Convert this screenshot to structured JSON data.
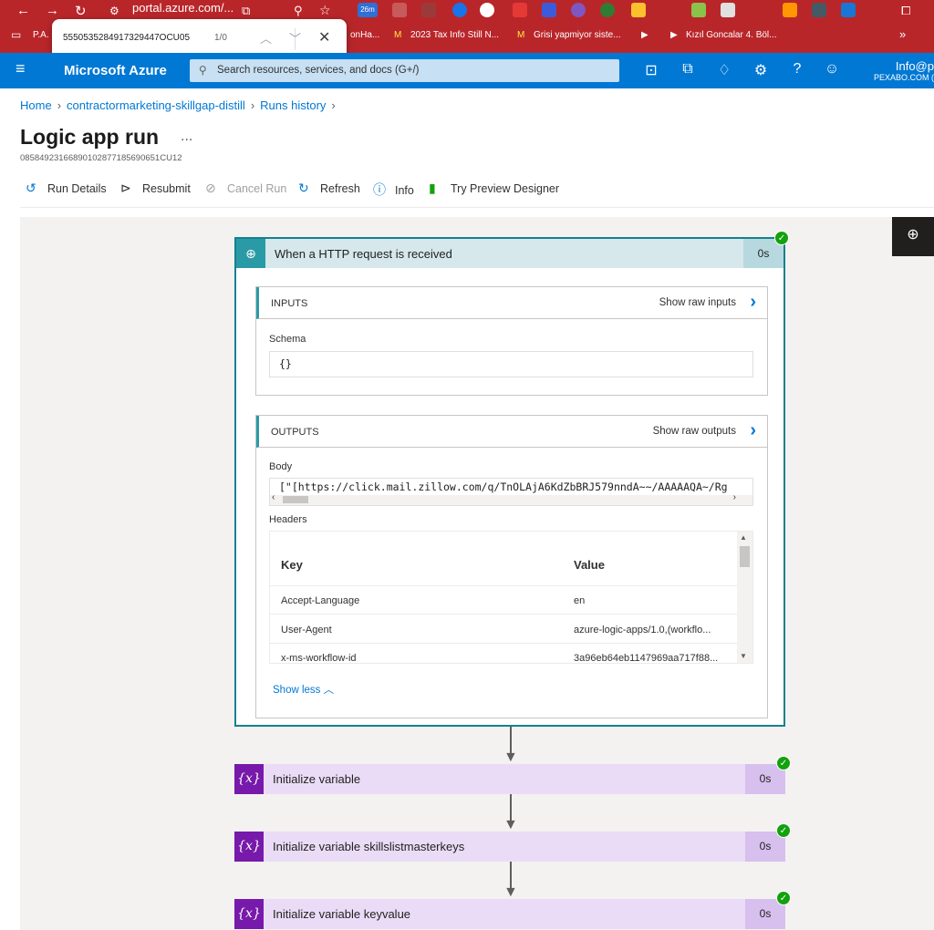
{
  "browser": {
    "url": "portal.azure.com/...",
    "badge_label": "26m",
    "bookmarks": [
      "P.A.",
      "onHa...",
      "2023 Tax Info Still N...",
      "Grisi yapmiyor siste...",
      "Kızıl Goncalar 4. Böl..."
    ],
    "more": "»"
  },
  "find_bar": {
    "query": "5550535284917329447OCU05",
    "count": "1/0"
  },
  "azure": {
    "brand": "Microsoft Azure",
    "search_placeholder": "Search resources, services, and docs (G+/)",
    "account_name": "Info@p",
    "account_org": "PEXABO.COM ("
  },
  "breadcrumb": [
    "Home",
    "contractormarketing-skillgap-distill",
    "Runs history"
  ],
  "page": {
    "title": "Logic app run",
    "more": "...",
    "run_id": "08584923166890102877185690651CU12"
  },
  "toolbar": {
    "run_details": "Run Details",
    "resubmit": "Resubmit",
    "cancel_run": "Cancel Run",
    "refresh": "Refresh",
    "info": "Info",
    "preview": "Try Preview Designer"
  },
  "http_step": {
    "title": "When a HTTP request is received",
    "duration": "0s",
    "inputs_label": "INPUTS",
    "show_raw_inputs": "Show raw inputs",
    "schema_label": "Schema",
    "schema_value": "{}",
    "outputs_label": "OUTPUTS",
    "show_raw_outputs": "Show raw outputs",
    "body_label": "Body",
    "body_value": "[\"[https://click.mail.zillow.com/q/TnOLAjA6KdZbBRJ579nndA~~/AAAAAQA~/Rg",
    "headers_label": "Headers",
    "headers_columns": [
      "Key",
      "Value"
    ],
    "headers": [
      {
        "key": "Accept-Language",
        "value": "en"
      },
      {
        "key": "User-Agent",
        "value": "azure-logic-apps/1.0,(workflo..."
      },
      {
        "key": "x-ms-workflow-id",
        "value": "3a96eb64eb1147969aa717f88..."
      }
    ],
    "show_less": "Show less"
  },
  "steps": [
    {
      "title": "Initialize variable",
      "duration": "0s"
    },
    {
      "title": "Initialize variable skillslistmasterkeys",
      "duration": "0s"
    },
    {
      "title": "Initialize variable keyvalue",
      "duration": "0s"
    }
  ],
  "colors": {
    "browser_bar": "#b9262a",
    "azure_blue": "#0078d4",
    "http_teal": "#15818e",
    "variable_purple": "#7719aa",
    "success_green": "#13a10e"
  }
}
